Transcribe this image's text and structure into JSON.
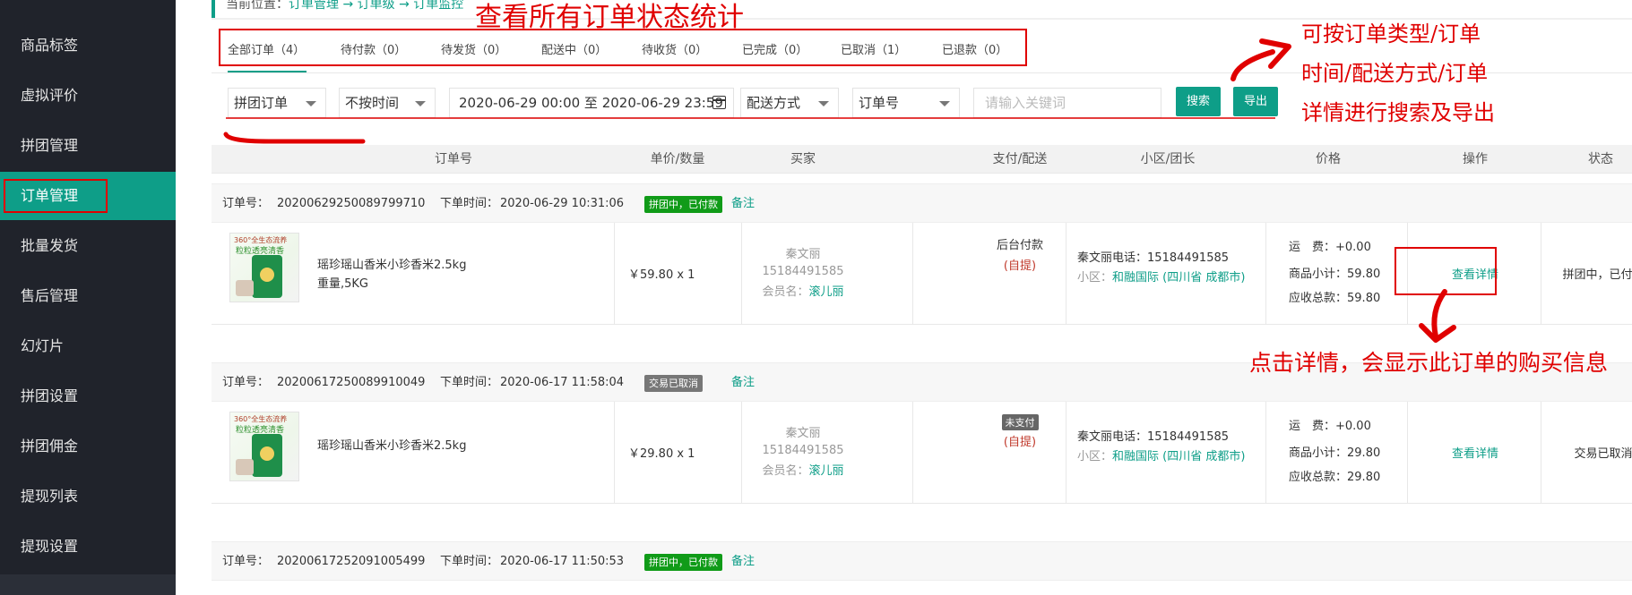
{
  "sidebar": {
    "items": [
      {
        "label": "商品标签"
      },
      {
        "label": "虚拟评价"
      },
      {
        "label": "拼团管理"
      },
      {
        "label": "订单管理"
      },
      {
        "label": "批量发货"
      },
      {
        "label": "售后管理"
      },
      {
        "label": "幻灯片"
      },
      {
        "label": "拼团设置"
      },
      {
        "label": "拼团佣金"
      },
      {
        "label": "提现列表"
      },
      {
        "label": "提现设置"
      }
    ],
    "active_index": 3
  },
  "breadcrumb": {
    "prefix": "当前位置：",
    "part1": "订单管理",
    "sep": " → ",
    "part2": "订单级",
    "part3": "订单监控"
  },
  "tabs": [
    {
      "label": "全部订单（4）"
    },
    {
      "label": "待付款（0）"
    },
    {
      "label": "待发货（0）"
    },
    {
      "label": "配送中（0）"
    },
    {
      "label": "待收货（0）"
    },
    {
      "label": "已完成（0）"
    },
    {
      "label": "已取消（1）"
    },
    {
      "label": "已退款（0）"
    }
  ],
  "filters": {
    "order_type": "拼团订单",
    "time_mode": "不按时间",
    "date_range": "2020-06-29 00:00 至 2020-06-29 23:59",
    "delivery": "配送方式",
    "field": "订单号",
    "keyword_placeholder": "请输入关键词",
    "search_label": "搜索",
    "export_label": "导出"
  },
  "table_headers": [
    "订单号",
    "单价/数量",
    "买家",
    "支付/配送",
    "小区/团长",
    "价格",
    "操作",
    "状态"
  ],
  "labels": {
    "order_no": "订单号：",
    "order_time": "下单时间：",
    "remark": "备注",
    "view_detail": "查看详情",
    "buyer_member": "会员名：",
    "shipping": "运　费：",
    "subtotal": "商品小计：",
    "total": "应收总款：",
    "community": "小区：",
    "phone_suffix": "电话："
  },
  "orders": [
    {
      "order_no": "20200629250089799710",
      "time": "2020-06-29  10:31:06",
      "badge": "拼团中，已付款",
      "product_name": "瑶珍瑶山香米小珍香米2.5kg",
      "product_spec": "重量,5KG",
      "price_qty": "￥59.80 x 1",
      "buyer_name": "秦文丽",
      "buyer_phone": "15184491585",
      "member_name": "滚儿丽",
      "pay_method": "后台付款",
      "delivery": "(自提)",
      "leader_name": "秦文丽",
      "leader_phone": "15184491585",
      "community": "和融国际 (四川省 成都市)",
      "shipping_fee": "+0.00",
      "subtotal": "59.80",
      "total": "59.80",
      "status": "拼团中，已付款"
    },
    {
      "order_no": "20200617250089910049⁠⁠",
      "time": "2020-06-17  11:58:04",
      "badge": "交易已取消",
      "product_name": "瑶珍瑶山香米小珍香米2.5kg",
      "product_spec": "",
      "price_qty": "￥29.80 x 1",
      "buyer_name": "秦文丽",
      "buyer_phone": "15184491585",
      "member_name": "滚儿丽",
      "pay_method": "未支付",
      "delivery": "(自提)",
      "leader_name": "秦文丽",
      "leader_phone": "15184491585",
      "community": "和融国际 (四川省 成都市)",
      "shipping_fee": "+0.00",
      "subtotal": "29.80",
      "total": "29.80",
      "status": "交易已取消"
    },
    {
      "order_no": "20200617252091005499⁠",
      "time": "2020-06-17  11:50:53",
      "badge": "拼团中，已付款"
    }
  ],
  "product_image": {
    "line1": "360°全生态流养",
    "line2": "粒粒透亮清香"
  },
  "annotations": {
    "stats": "查看所有订单状态统计",
    "search_line1": "可按订单类型/订单",
    "search_line2": "时间/配送方式/订单",
    "search_line3": "详情进行搜索及导出",
    "detail": "点击详情，会显示此订单的购买信息"
  },
  "colors": {
    "accent": "#0e9e88",
    "sidebar_bg": "#20232b",
    "annotation": "#e00000",
    "badge_paid": "#109b18",
    "badge_cancel": "#777777"
  }
}
